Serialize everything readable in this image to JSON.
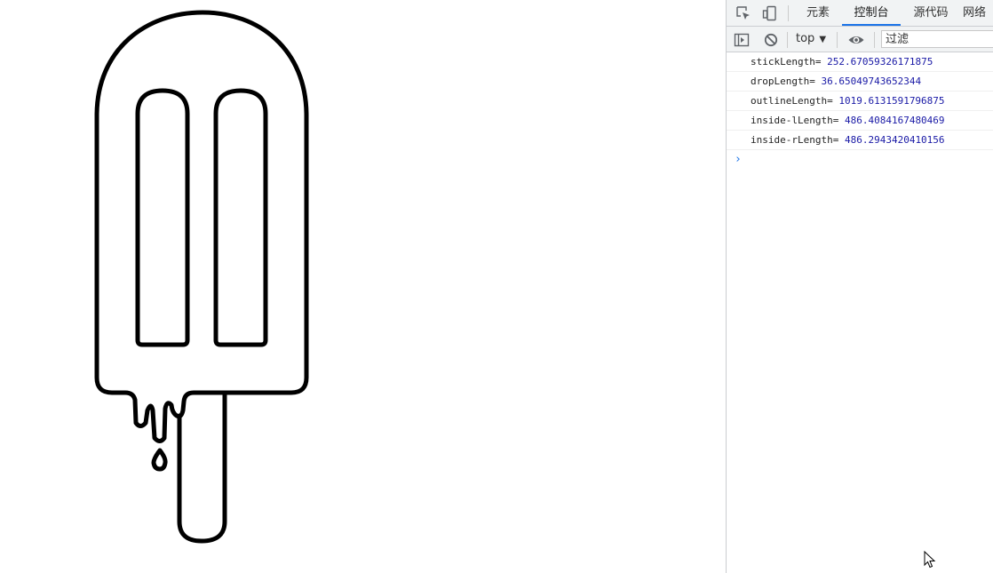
{
  "devtools": {
    "tabs": [
      {
        "label": "元素",
        "active": false
      },
      {
        "label": "控制台",
        "active": true
      },
      {
        "label": "源代码",
        "active": false
      },
      {
        "label": "网络",
        "active": false
      }
    ],
    "toolbar": {
      "context": "top",
      "filter_placeholder": "过滤"
    },
    "console": {
      "logs": [
        {
          "key": "stickLength=",
          "value": "252.67059326171875"
        },
        {
          "key": "dropLength=",
          "value": "36.65049743652344"
        },
        {
          "key": "outlineLength=",
          "value": "1019.6131591796875"
        },
        {
          "key": "inside-lLength=",
          "value": "486.4084167480469"
        },
        {
          "key": "inside-rLength=",
          "value": "486.2943420410156"
        }
      ],
      "prompt_symbol": "›"
    }
  },
  "icons": [
    "inspect-icon",
    "device-toolbar-icon",
    "sidebar-toggle-icon",
    "clear-console-icon",
    "eye-icon",
    "mouse-cursor-icon"
  ],
  "colors": {
    "accent": "#1a73e8",
    "log_value": "#1a1aa6"
  }
}
